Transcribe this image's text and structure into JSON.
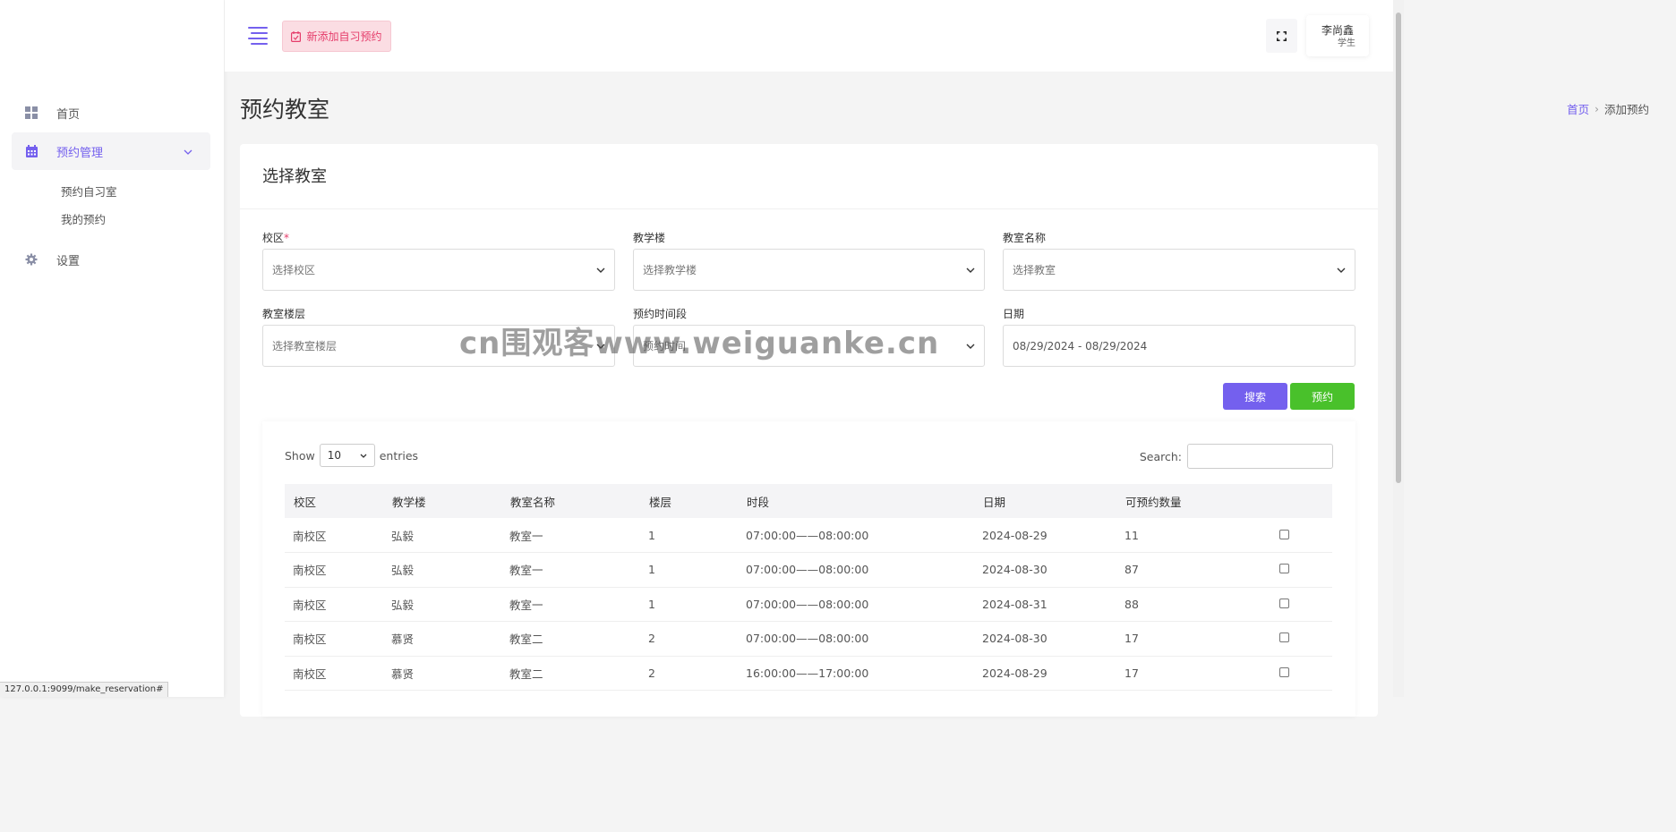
{
  "sidebar": {
    "items": [
      {
        "label": "首页",
        "icon": "dashboard-icon"
      },
      {
        "label": "预约管理",
        "icon": "calendar-icon",
        "active": true,
        "expanded": true,
        "children": [
          {
            "label": "预约自习室"
          },
          {
            "label": "我的预约"
          }
        ]
      },
      {
        "label": "设置",
        "icon": "gear-icon"
      }
    ]
  },
  "topbar": {
    "new_button_label": "新添加自习预约",
    "user_name": "李尚鑫",
    "user_role": "学生"
  },
  "page": {
    "title": "预约教室",
    "breadcrumb": {
      "home": "首页",
      "current": "添加预约"
    }
  },
  "card": {
    "title": "选择教室",
    "fields": {
      "campus": {
        "label": "校区",
        "required_mark": "*",
        "placeholder": "选择校区"
      },
      "building": {
        "label": "教学楼",
        "placeholder": "选择教学楼"
      },
      "room": {
        "label": "教室名称",
        "placeholder": "选择教室"
      },
      "floor": {
        "label": "教室楼层",
        "placeholder": "选择教室楼层"
      },
      "period": {
        "label": "预约时间段",
        "placeholder": "预约时间"
      },
      "date": {
        "label": "日期",
        "value": "08/29/2024 - 08/29/2024"
      }
    },
    "search_label": "搜索",
    "reserve_label": "预约"
  },
  "table": {
    "show_label": "Show",
    "page_size": "10",
    "entries_label": "entries",
    "search_label": "Search:",
    "columns": [
      "校区",
      "教学楼",
      "教室名称",
      "楼层",
      "时段",
      "日期",
      "可预约数量"
    ],
    "rows": [
      [
        "南校区",
        "弘毅",
        "教室一",
        "1",
        "07:00:00——08:00:00",
        "2024-08-29",
        "11"
      ],
      [
        "南校区",
        "弘毅",
        "教室一",
        "1",
        "07:00:00——08:00:00",
        "2024-08-30",
        "87"
      ],
      [
        "南校区",
        "弘毅",
        "教室一",
        "1",
        "07:00:00——08:00:00",
        "2024-08-31",
        "88"
      ],
      [
        "南校区",
        "慕贤",
        "教室二",
        "2",
        "07:00:00——08:00:00",
        "2024-08-30",
        "17"
      ],
      [
        "南校区",
        "慕贤",
        "教室二",
        "2",
        "16:00:00——17:00:00",
        "2024-08-29",
        "17"
      ]
    ]
  },
  "watermark": "cn围观客www.weiguanke.cn",
  "statusbar_url": "127.0.0.1:9099/make_reservation#",
  "colors": {
    "accent": "#7460ee",
    "success": "#49c12b",
    "pink": "#e53d6b"
  }
}
